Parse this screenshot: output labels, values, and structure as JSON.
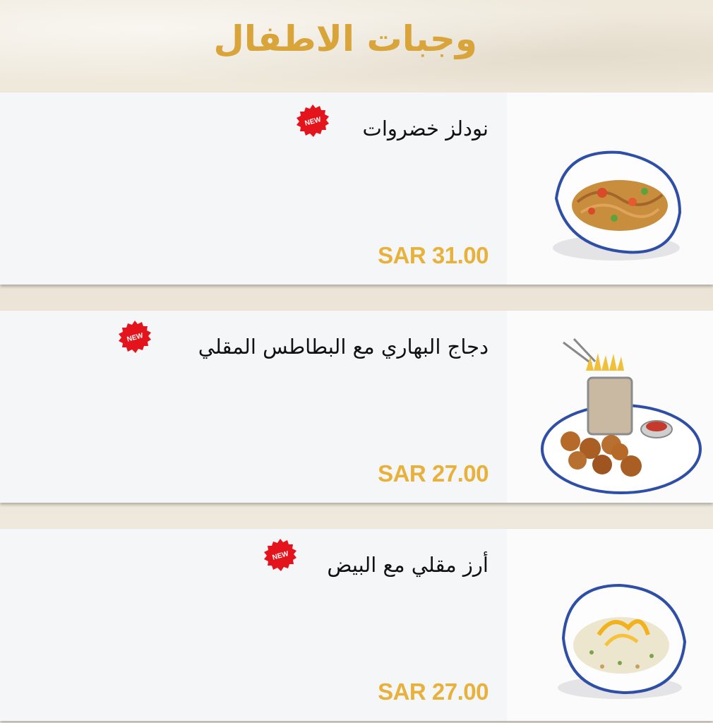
{
  "header": {
    "title": "وجبات الاطفال"
  },
  "colors": {
    "title": "#d9a43a",
    "price": "#e8b13c",
    "badge": "#e3141b",
    "card": "#f5f6f8"
  },
  "items": [
    {
      "name": "نودلز خضروات",
      "price": "SAR 31.00",
      "badge": "NEW",
      "photo_icon": "noodles-bowl-icon"
    },
    {
      "name": "دجاج البهاري مع البطاطس المقلي",
      "price": "SAR 27.00",
      "badge": "NEW",
      "photo_icon": "chicken-fries-plate-icon"
    },
    {
      "name": "أرز مقلي مع البيض",
      "price": "SAR 27.00",
      "badge": "NEW",
      "photo_icon": "fried-rice-bowl-icon"
    }
  ]
}
